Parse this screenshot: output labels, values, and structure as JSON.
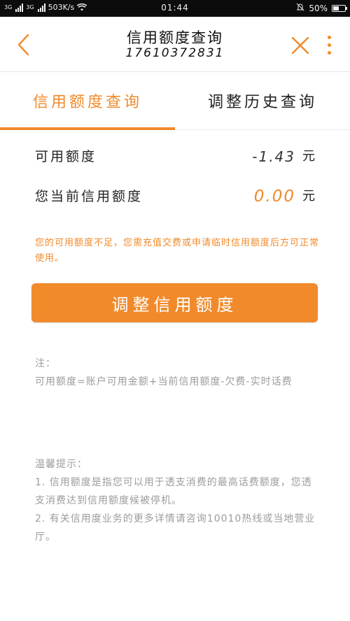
{
  "status_bar": {
    "signal1_label": "3G",
    "signal2_label": "3G",
    "net_speed": "503K/s",
    "time": "01:44",
    "battery_text": "50%",
    "battery_level": 0.5
  },
  "header": {
    "title": "信用额度查询",
    "subtitle": "17610372831"
  },
  "tabs": [
    {
      "label": "信用额度查询",
      "active": true
    },
    {
      "label": "调整历史查询",
      "active": false
    }
  ],
  "rows": {
    "available": {
      "label": "可用额度",
      "value": "-1.43",
      "unit": "元"
    },
    "current": {
      "label": "您当前信用额度",
      "value": "0.00",
      "unit": "元"
    }
  },
  "warning": "您的可用额度不足，您需充值交费或申请临时信用额度后方可正常使用。",
  "adjust_button": "调整信用额度",
  "note": {
    "title": "注：",
    "text": "可用额度=账户可用金额+当前信用额度-欠费-实时话费"
  },
  "tips": {
    "title": "温馨提示：",
    "item1": "1. 信用额度是指您可以用于透支消费的最高话费额度，您透支消费达到信用额度候被停机。",
    "item2": "2. 有关信用度业务的更多详情请咨询10010热线或当地营业厅。"
  },
  "colors": {
    "accent": "#f18a2b",
    "muted_text": "#9c9c9c",
    "status_bar_bg": "#0c0c0c"
  },
  "icons": {
    "back": "chevron-left-icon",
    "close": "close-icon",
    "more": "more-vertical-icon",
    "wifi": "wifi-icon",
    "mute": "bell-off-icon",
    "battery": "battery-icon"
  }
}
